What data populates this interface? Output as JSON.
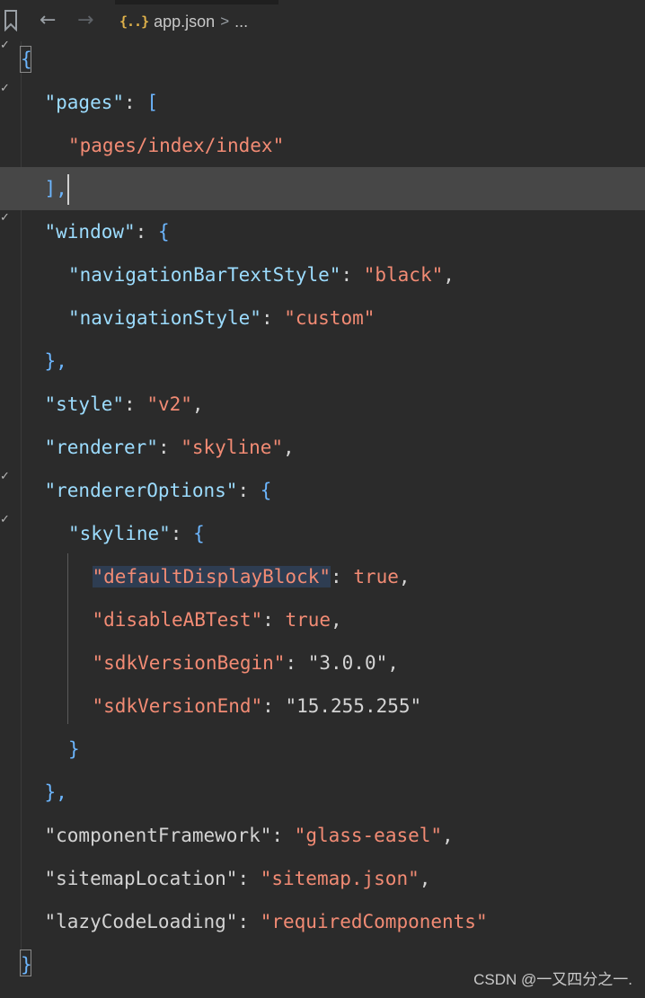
{
  "toolbar": {
    "bookmark_icon": "bookmark-icon",
    "back_icon": "arrow-left-icon",
    "forward_icon": "arrow-right-icon",
    "file_icon_glyph": "{..}",
    "file_name": "app.json",
    "crumb_separator": ">",
    "crumb_more": "..."
  },
  "editor": {
    "lines": [
      {
        "indent": 0,
        "parts": [
          {
            "t": "{",
            "c": "brace-blue"
          }
        ]
      },
      {
        "indent": 1,
        "parts": [
          {
            "t": "\"pages\"",
            "c": "k"
          },
          {
            "t": ": ",
            "c": "p"
          },
          {
            "t": "[",
            "c": "brace-blue"
          }
        ]
      },
      {
        "indent": 2,
        "parts": [
          {
            "t": "\"pages/index/index\"",
            "c": "s"
          }
        ]
      },
      {
        "indent": 1,
        "current": true,
        "parts": [
          {
            "t": "],",
            "c": "brace-blue"
          }
        ]
      },
      {
        "indent": 1,
        "parts": [
          {
            "t": "\"window\"",
            "c": "k"
          },
          {
            "t": ": ",
            "c": "p"
          },
          {
            "t": "{",
            "c": "brace-blue"
          }
        ]
      },
      {
        "indent": 2,
        "parts": [
          {
            "t": "\"navigationBarTextStyle\"",
            "c": "k"
          },
          {
            "t": ": ",
            "c": "p"
          },
          {
            "t": "\"black\"",
            "c": "s"
          },
          {
            "t": ",",
            "c": "p"
          }
        ]
      },
      {
        "indent": 2,
        "parts": [
          {
            "t": "\"navigationStyle\"",
            "c": "k"
          },
          {
            "t": ": ",
            "c": "p"
          },
          {
            "t": "\"custom\"",
            "c": "s"
          }
        ]
      },
      {
        "indent": 1,
        "parts": [
          {
            "t": "},",
            "c": "brace-blue"
          }
        ]
      },
      {
        "indent": 1,
        "parts": [
          {
            "t": "\"style\"",
            "c": "k"
          },
          {
            "t": ": ",
            "c": "p"
          },
          {
            "t": "\"v2\"",
            "c": "s"
          },
          {
            "t": ",",
            "c": "p"
          }
        ]
      },
      {
        "indent": 1,
        "parts": [
          {
            "t": "\"renderer\"",
            "c": "k"
          },
          {
            "t": ": ",
            "c": "p"
          },
          {
            "t": "\"skyline\"",
            "c": "s"
          },
          {
            "t": ",",
            "c": "p"
          }
        ]
      },
      {
        "indent": 1,
        "parts": [
          {
            "t": "\"rendererOptions\"",
            "c": "k"
          },
          {
            "t": ": ",
            "c": "p"
          },
          {
            "t": "{",
            "c": "brace-blue"
          }
        ]
      },
      {
        "indent": 2,
        "parts": [
          {
            "t": "\"skyline\"",
            "c": "k"
          },
          {
            "t": ": ",
            "c": "p"
          },
          {
            "t": "{",
            "c": "brace-blue"
          }
        ]
      },
      {
        "indent": 3,
        "parts": [
          {
            "t": "\"defaultDisplayBlock\"",
            "c": "s",
            "sel": true
          },
          {
            "t": ": ",
            "c": "p"
          },
          {
            "t": "true",
            "c": "s"
          },
          {
            "t": ",",
            "c": "p"
          }
        ]
      },
      {
        "indent": 3,
        "parts": [
          {
            "t": "\"disableABTest\"",
            "c": "s"
          },
          {
            "t": ": ",
            "c": "p"
          },
          {
            "t": "true",
            "c": "s"
          },
          {
            "t": ",",
            "c": "p"
          }
        ]
      },
      {
        "indent": 3,
        "parts": [
          {
            "t": "\"sdkVersionBegin\"",
            "c": "s"
          },
          {
            "t": ": ",
            "c": "p"
          },
          {
            "t": "\"3.0.0\"",
            "c": "p"
          },
          {
            "t": ",",
            "c": "p"
          }
        ]
      },
      {
        "indent": 3,
        "parts": [
          {
            "t": "\"sdkVersionEnd\"",
            "c": "s"
          },
          {
            "t": ": ",
            "c": "p"
          },
          {
            "t": "\"15.255.255\"",
            "c": "p"
          }
        ]
      },
      {
        "indent": 2,
        "parts": [
          {
            "t": "}",
            "c": "brace-blue"
          }
        ]
      },
      {
        "indent": 1,
        "parts": [
          {
            "t": "},",
            "c": "brace-blue"
          }
        ]
      },
      {
        "indent": 1,
        "parts": [
          {
            "t": "\"componentFramework\"",
            "c": "p"
          },
          {
            "t": ": ",
            "c": "p"
          },
          {
            "t": "\"glass-easel\"",
            "c": "s"
          },
          {
            "t": ",",
            "c": "p"
          }
        ]
      },
      {
        "indent": 1,
        "parts": [
          {
            "t": "\"sitemapLocation\"",
            "c": "p"
          },
          {
            "t": ": ",
            "c": "p"
          },
          {
            "t": "\"sitemap.json\"",
            "c": "s"
          },
          {
            "t": ",",
            "c": "p"
          }
        ]
      },
      {
        "indent": 1,
        "parts": [
          {
            "t": "\"lazyCodeLoading\"",
            "c": "p"
          },
          {
            "t": ": ",
            "c": "p"
          },
          {
            "t": "\"requiredComponents\"",
            "c": "s"
          }
        ]
      },
      {
        "indent": 0,
        "parts": [
          {
            "t": "}",
            "c": "brace-blue"
          }
        ]
      }
    ],
    "fold_marks": [
      "check-icon",
      "check-icon",
      "check-icon",
      "check-icon",
      "check-icon"
    ],
    "colors": {
      "key": "#9cdcfe",
      "string": "#f28b74",
      "punct": "#d4d4d4",
      "brace": "#6cb6ff",
      "current_line": "#474747",
      "background": "#2b2b2b"
    }
  },
  "watermark": "CSDN @一又四分之一."
}
